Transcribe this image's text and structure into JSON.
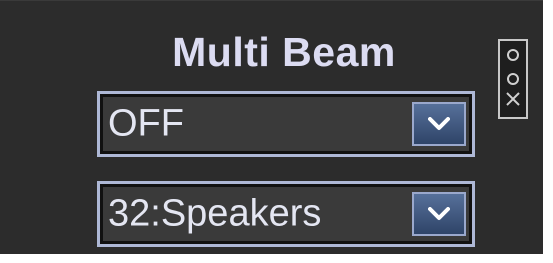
{
  "panel": {
    "title": "Multi Beam"
  },
  "beam_select": {
    "value": "OFF",
    "icon": "chevron-down-icon"
  },
  "speaker_select": {
    "value": "32:Speakers",
    "icon": "chevron-down-icon"
  },
  "side_handle": {
    "icon": "grip-handle-icon"
  }
}
